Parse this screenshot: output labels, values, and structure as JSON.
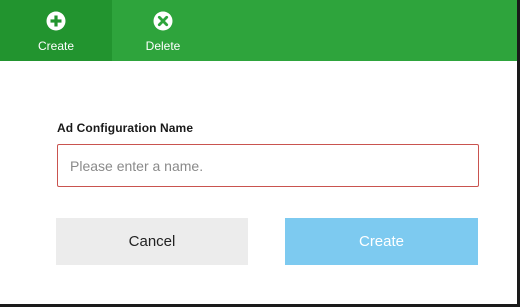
{
  "toolbar": {
    "create_label": "Create",
    "create_icon": "plus-circle-icon",
    "delete_label": "Delete",
    "delete_icon": "x-circle-icon",
    "background_color": "#2ea43c",
    "active_item_color": "#22942f"
  },
  "form": {
    "name_label": "Ad Configuration Name",
    "name_value": "",
    "name_placeholder": "Please enter a name.",
    "name_border_color": "#c9534f"
  },
  "actions": {
    "cancel_label": "Cancel",
    "create_label": "Create",
    "create_button_color": "#7dcaf0",
    "cancel_button_color": "#ececec"
  }
}
